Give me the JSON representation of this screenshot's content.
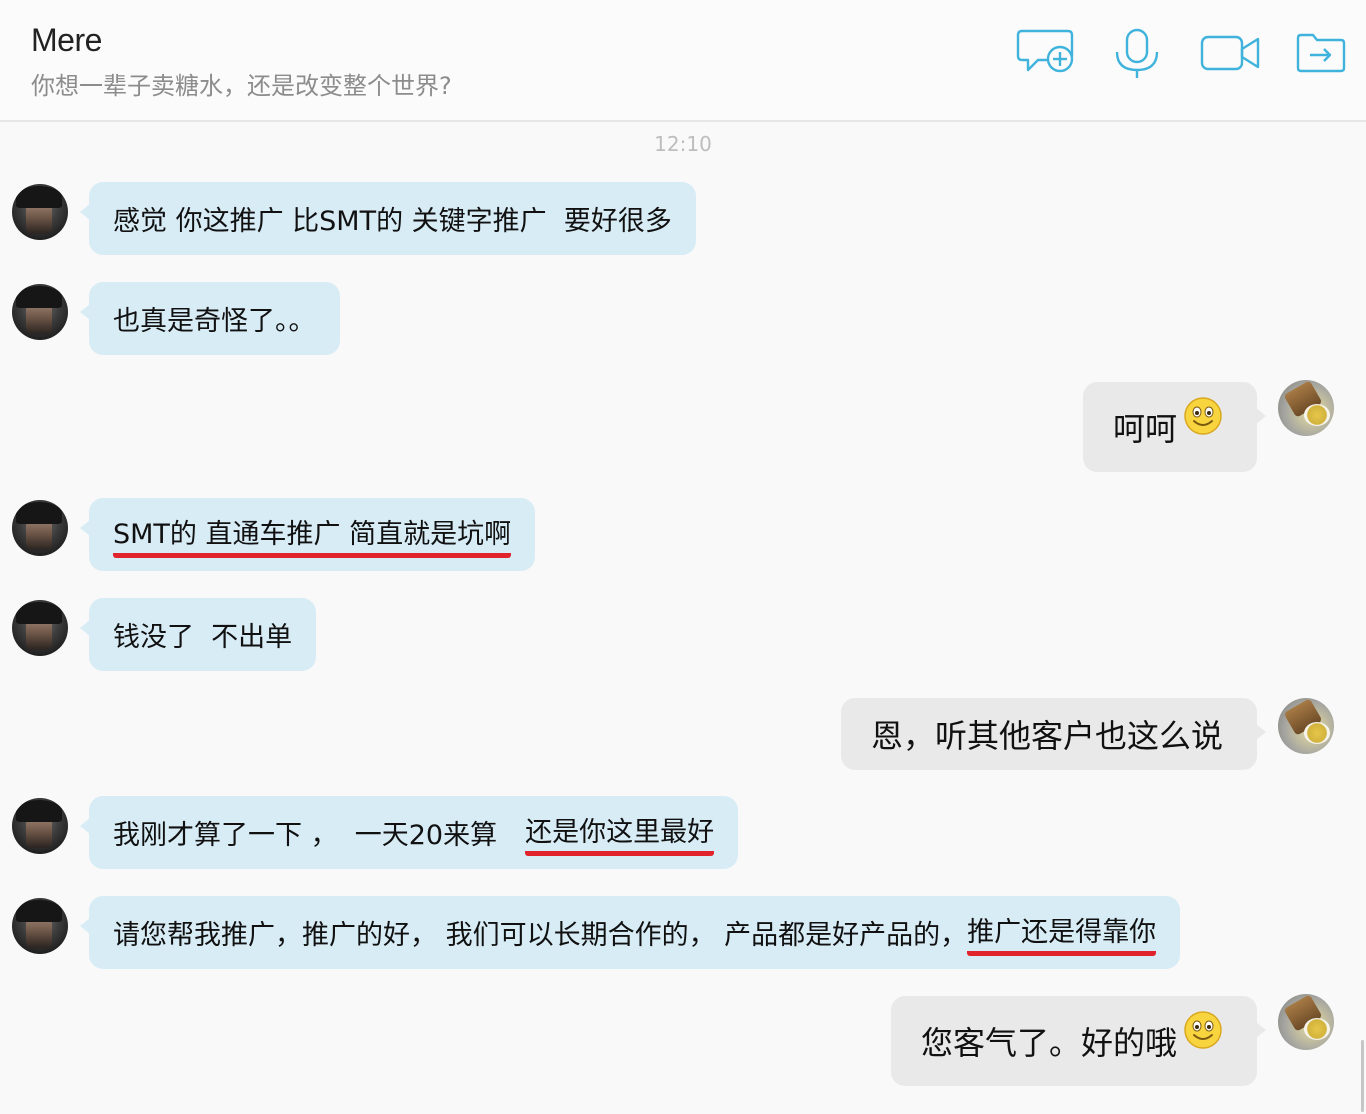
{
  "header": {
    "contact_name": "Mere",
    "status": "你想一辈子卖糖水，还是改变整个世界?",
    "icons": [
      "new-chat-icon",
      "microphone-icon",
      "video-camera-icon",
      "share-icon"
    ],
    "icon_color": "#3fb3dc"
  },
  "chat": {
    "timestamp": "12:10",
    "incoming_bubble_color": "#d8ecf6",
    "outgoing_bubble_color": "#e9e9e9",
    "highlight_color": "#e1242b",
    "messages": [
      {
        "sender": "contact",
        "parts": [
          "感觉 你这推广 比SMT的 关键字推广  要好很多"
        ]
      },
      {
        "sender": "contact",
        "parts": [
          "也真是奇怪了。。"
        ]
      },
      {
        "sender": "me",
        "parts": [
          "呵呵"
        ],
        "emoji": "smiley"
      },
      {
        "sender": "contact",
        "parts": [
          "SMT的 直通车推广 简直就是坑啊"
        ],
        "underlined": true
      },
      {
        "sender": "contact",
        "parts": [
          "钱没了  不出单"
        ]
      },
      {
        "sender": "me",
        "parts": [
          "恩，听其他客户也这么说"
        ]
      },
      {
        "sender": "contact",
        "parts": [
          "我刚才算了一下 ，  一天20来算",
          "还是你这里最好"
        ],
        "underlined_part": 1
      },
      {
        "sender": "contact",
        "parts": [
          "请您帮我推广，推广的好， 我们可以长期合作的， 产品都是好产品的，",
          "推广还是得靠你"
        ],
        "underlined_part": 1
      },
      {
        "sender": "me",
        "parts": [
          "您客气了。好的哦"
        ],
        "emoji": "smiley"
      }
    ]
  }
}
